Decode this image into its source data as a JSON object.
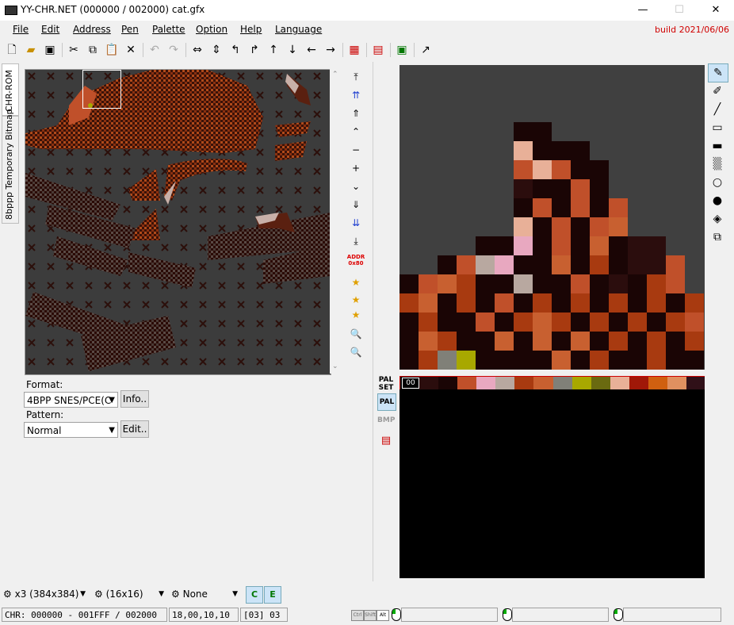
{
  "window": {
    "title": "YY-CHR.NET (000000 / 002000) cat.gfx",
    "minimize": "—",
    "maximize": "☐",
    "close": "✕"
  },
  "menu": {
    "items": [
      "File",
      "Edit",
      "Address",
      "Pen",
      "Palette",
      "Option",
      "Help",
      "Language"
    ],
    "build": "build 2021/06/06"
  },
  "left_tabs": [
    "CHR-ROM",
    "8bppp Temporary Bitmap"
  ],
  "format": {
    "format_label": "Format:",
    "format_value": "4BPP SNES/PCE(C",
    "info_button": "Info..",
    "pattern_label": "Pattern:",
    "pattern_value": "Normal",
    "edit_button": "Edit.."
  },
  "vertical_tools": {
    "addr_label_top": "ADDR",
    "addr_label_bottom": "0x80"
  },
  "palette": {
    "set_label_top": "PAL",
    "set_label_bottom": "SET",
    "pal_label": "PAL",
    "bmp_label": "BMP",
    "index_label": "00",
    "colors": [
      "#000000",
      "#2b0d0d",
      "#1a0505",
      "#c0502a",
      "#e8a8c0",
      "#b8a8a0",
      "#a83a10",
      "#c86030",
      "#808078",
      "#a8a800",
      "#6a6a10",
      "#e8b098",
      "#a01808",
      "#d06010",
      "#e09060",
      "#301018"
    ]
  },
  "bottom": {
    "zoom": "x3 (384x384)",
    "grid": "(16x16)",
    "mode": "None",
    "toggle1": "C",
    "toggle2": "E"
  },
  "status": {
    "chr": "CHR: 000000 - 001FFF / 002000",
    "coords": "18,00,10,10",
    "color": "[03] 03",
    "keys": [
      "Ctrl",
      "Shift",
      "Alt"
    ]
  }
}
